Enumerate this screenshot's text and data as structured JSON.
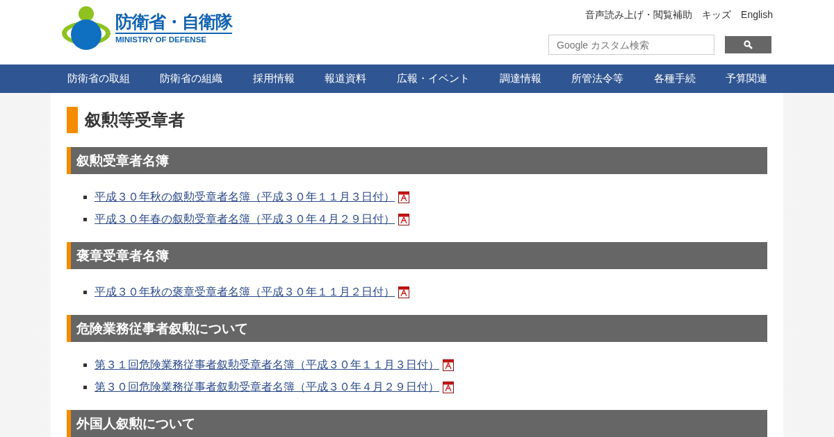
{
  "header": {
    "logo_title": "防衛省・自衛隊",
    "logo_subtitle": "MINISTRY OF DEFENSE",
    "utility_links": [
      "音声読み上げ・閲覧補助",
      "キッズ",
      "English"
    ],
    "search": {
      "placeholder": "Google カスタム検索"
    }
  },
  "nav": [
    "防衛省の取組",
    "防衛省の組織",
    "採用情報",
    "報道資料",
    "広報・イベント",
    "調達情報",
    "所管法令等",
    "各種手続",
    "予算関連"
  ],
  "page_title": "叙勲等受章者",
  "sections": [
    {
      "heading": "叙勲受章者名簿",
      "links": [
        "平成３０年秋の叙勲受章者名簿（平成３０年１１月３日付）",
        "平成３０年春の叙勲受章者名簿（平成３０年４月２９日付）"
      ]
    },
    {
      "heading": "褒章受章者名簿",
      "links": [
        "平成３０年秋の褒章受章者名簿（平成３０年１１月２日付）"
      ]
    },
    {
      "heading": "危険業務従事者叙勲について",
      "links": [
        "第３１回危険業務従事者叙勲受章者名簿（平成３０年１１月３日付）",
        "第３０回危険業務従事者叙勲受章者名簿（平成３０年４月２９日付）"
      ]
    },
    {
      "heading": "外国人叙勲について"
    }
  ]
}
